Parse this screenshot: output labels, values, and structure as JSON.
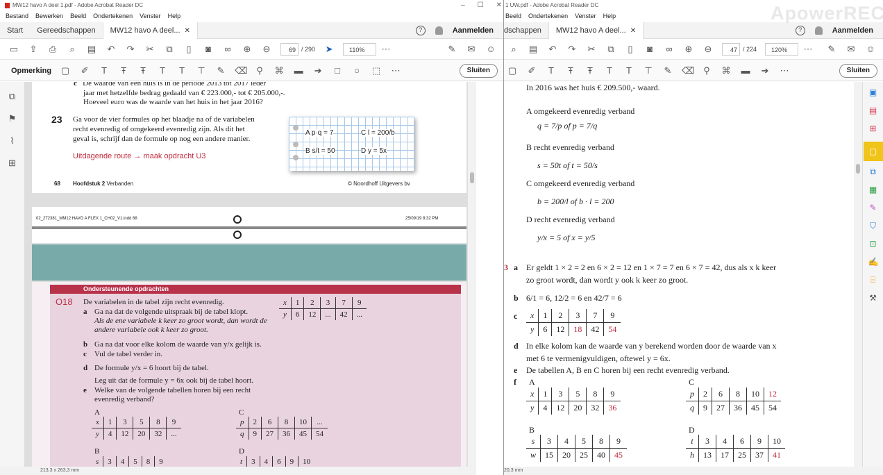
{
  "left": {
    "title": "MW12 havo A deel 1.pdf - Adobe Acrobat Reader DC",
    "menu": [
      "Bestand",
      "Bewerken",
      "Beeld",
      "Ondertekenen",
      "Venster",
      "Help"
    ],
    "tabs": {
      "home": "Start",
      "tools": "Gereedschappen",
      "doc": "MW12 havo A deel..."
    },
    "login": "Aanmelden",
    "page_current": "69",
    "page_total": "/ 290",
    "zoom": "110%",
    "annotation_label": "Opmerking",
    "close_label": "Sluiten",
    "status": "213,3 x 263,3 mm",
    "content": {
      "line_c1": "De waarde van een huis is in de periode 2013 tot 2017 ieder",
      "line_c2": "jaar met hetzelfde bedrag gedaald van € 223.000,- tot € 205.000,-.",
      "line_c3": "Hoeveel euro was de waarde van het huis in het jaar 2016?",
      "q23_num": "23",
      "q23_1": "Ga voor de vier formules op het blaadje na of de variabelen",
      "q23_2": "recht evenredig of omgekeerd evenredig zijn. Als dit het",
      "q23_3": "geval is, schrijf dan de formule op nog een andere manier.",
      "route": "Uitdagende route → maak opdracht U3",
      "sticky_a": "A   p·q = 7",
      "sticky_c": "C   l = 200/b",
      "sticky_b": "B   s/t = 50",
      "sticky_d": "D   y = 5x",
      "footer_page": "68",
      "footer_chapter": "Hoofdstuk 2",
      "footer_chapter_title": "Verbanden",
      "footer_pub": "© Noordhoff Uitgevers bv",
      "slug_left": "02_272381_MM12 HAVO A FLEX 1_CH02_V1.indd   68",
      "slug_date": "25/09/19   8:32 PM",
      "section_head": "Ondersteunende opdrachten",
      "o18": "O18",
      "o18_intro": "De variabelen in de tabel zijn recht evenredig.",
      "a_lbl": "a",
      "a_1": "Ga na dat de volgende uitspraak bij de tabel klopt.",
      "a_2": "Als de ene variabele k keer zo groot wordt, dan wordt de",
      "a_3": "andere variabele ook k keer zo groot.",
      "b_lbl": "b",
      "b_text": "Ga na dat voor elke kolom de waarde van y/x gelijk is.",
      "c_lbl": "c",
      "c_text": "Vul de tabel verder in.",
      "d_lbl": "d",
      "d_text": "De formule y/x = 6 hoort bij de tabel.",
      "d_2": "Leg uit dat de formule y = 6x ook bij de tabel hoort.",
      "e_lbl": "e",
      "e_1": "Welke van de volgende tabellen horen bij een recht",
      "e_2": "evenredig verband?",
      "tA": "A",
      "tB": "B",
      "tC": "C",
      "tD": "D",
      "main_table": [
        [
          "x",
          "1",
          "2",
          "3",
          "7",
          "9"
        ],
        [
          "y",
          "6",
          "12",
          "...",
          "42",
          "..."
        ]
      ],
      "table_A": [
        [
          "x",
          "1",
          "3",
          "5",
          "8",
          "9"
        ],
        [
          "y",
          "4",
          "12",
          "20",
          "32",
          "..."
        ]
      ],
      "table_C": [
        [
          "p",
          "2",
          "6",
          "8",
          "10",
          "..."
        ],
        [
          "q",
          "9",
          "27",
          "36",
          "45",
          "54"
        ]
      ],
      "table_B": [
        [
          "s",
          "3",
          "4",
          "5",
          "8",
          "9"
        ]
      ],
      "table_D": [
        [
          "t",
          "3",
          "4",
          "6",
          "9",
          "10"
        ]
      ]
    }
  },
  "right": {
    "title": "1 UW.pdf - Adobe Acrobat Reader DC",
    "menu": [
      "Beeld",
      "Ondertekenen",
      "Venster",
      "Help"
    ],
    "tabs": {
      "tools": "dschappen",
      "doc": "MW12 havo A deel..."
    },
    "login": "Aanmelden",
    "page_current": "47",
    "page_total": "/ 224",
    "zoom": "120%",
    "close_label": "Sluiten",
    "status": "20,3 mm",
    "watermark": "ApowerREC",
    "content": {
      "top": "In 2016 was het huis € 209.500,- waard.",
      "A_head": "A   omgekeerd evenredig verband",
      "A_formula": "q = 7/p of p = 7/q",
      "B_head": "B   recht evenredig verband",
      "B_formula": "s = 50t of t = 50/s",
      "C_head": "C   omgekeerd evenredig verband",
      "C_formula": "b = 200/l of b · l = 200",
      "D_head": "D   recht evenredig verband",
      "D_formula": "y/x = 5 of x = y/5",
      "q_num": "3",
      "a_lbl": "a",
      "a_1": "Er geldt 1 × 2 = 2 en 6 × 2 = 12 en 1 × 7 = 7 en 6 × 7 = 42, dus als x k keer",
      "a_2": "zo groot wordt, dan wordt y ook k keer zo groot.",
      "b_lbl": "b",
      "b_text": "6/1 = 6, 12/2 = 6 en 42/7 = 6",
      "c_lbl": "c",
      "table_c": [
        [
          "x",
          "1",
          "2",
          "3",
          "7",
          "9"
        ],
        [
          "y",
          "6",
          "12",
          "18",
          "42",
          "54"
        ]
      ],
      "d_lbl": "d",
      "d_1": "In elke kolom kan de waarde van y berekend worden door de waarde van x",
      "d_2": "met 6 te vermenigvuldigen, oftewel y = 6x.",
      "e_lbl": "e",
      "e_text": "De tabellen A, B en C horen bij een recht evenredig verband.",
      "f_lbl": "f",
      "fA": "A",
      "fB": "B",
      "fC": "C",
      "fD": "D",
      "table_fA": [
        [
          "x",
          "1",
          "3",
          "5",
          "8",
          "9"
        ],
        [
          "y",
          "4",
          "12",
          "20",
          "32",
          "36"
        ]
      ],
      "table_fC": [
        [
          "p",
          "2",
          "6",
          "8",
          "10",
          "12"
        ],
        [
          "q",
          "9",
          "27",
          "36",
          "45",
          "54"
        ]
      ],
      "table_fB": [
        [
          "s",
          "3",
          "4",
          "5",
          "8",
          "9"
        ],
        [
          "w",
          "15",
          "20",
          "25",
          "40",
          "45"
        ]
      ],
      "table_fD": [
        [
          "t",
          "3",
          "4",
          "6",
          "9",
          "10"
        ],
        [
          "h",
          "13",
          "17",
          "25",
          "37",
          "41"
        ]
      ]
    }
  },
  "colors": {
    "accent": "#c0293b",
    "teal": "#78aaa9",
    "pink_box": "#e9d3df",
    "section_red": "#b8324a",
    "highlight": "#f0c419"
  }
}
